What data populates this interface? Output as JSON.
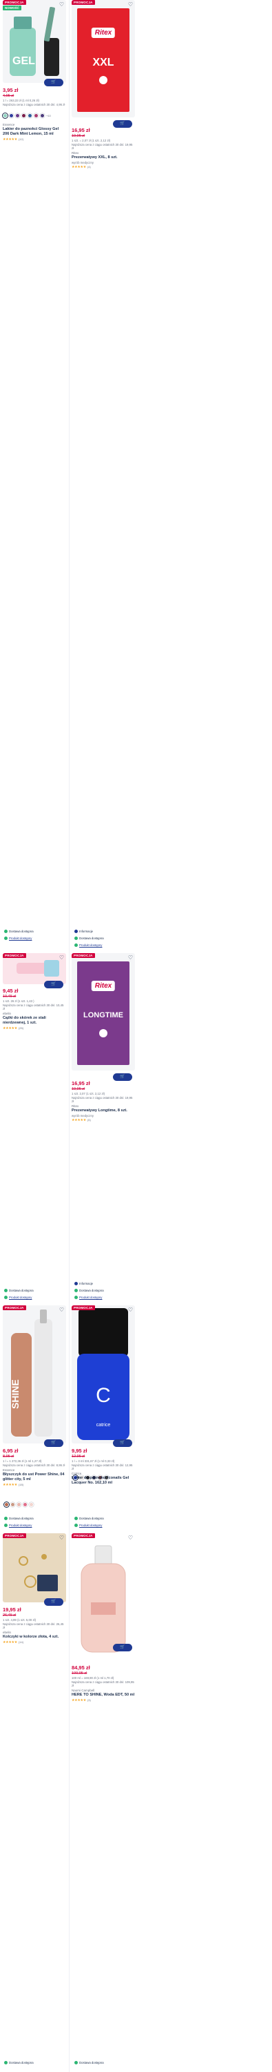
{
  "colors": {
    "accent": "#d2003c",
    "primary": "#1f3a93",
    "badge_green": "#2bb673",
    "star": "#f5a623"
  },
  "cart_icon": "cart-icon",
  "heart_icon": "heart-icon",
  "products": [
    {
      "badge": "PROMOCJA",
      "badge2": "NOWOŚĆ",
      "image_text": "GEL",
      "price": "3,95 zł",
      "old_price": "4,95 zł",
      "unit": "1 l = 263,33 zł (1 ml 0,26 zł)",
      "lowest": "Najniższa cena z ciągu ostatnich 30 dni: 4,95 zł",
      "brand": "Essence",
      "name": "Lakier do paznokci Glossy Gel 206 Dark Mint Lemon, 15 ml",
      "stars": "★★★★★",
      "reviews": "(12)",
      "swatches_more": "+10",
      "swatches": [
        "#8fd3c0",
        "#2f3e9e",
        "#6b3b8c",
        "#7a1f4a",
        "#2c5e9e",
        "#a93b6e",
        "#4c3b7c"
      ]
    },
    {
      "badge": "PROMOCJA",
      "image_brand": "Ritex",
      "image_text": "XXL",
      "price": "16,95 zł",
      "old_price": "19,95 zł",
      "unit": "1 szt. = 2,07 zł (1 szt. 2,12 zł)",
      "lowest": "Najniższa cena z ciągu ostatnich 30 dni: 19,95 zł",
      "brand": "Ritex",
      "name": "Prezerwatywy XXL, 8 szt.",
      "subinfo": "wyrób medyczny",
      "stars": "★★★★★",
      "reviews": "(4)"
    },
    {
      "badge": "PROMOCJA",
      "price": "9,45 zł",
      "old_price": "10,45 zł",
      "unit": "1 szt. 26 zł (1 szt. 1,43 )",
      "lowest": "Najniższa cena z ciągu ostatnich 30 dni: 10,45 zł",
      "brand": "ebelin",
      "name": "Cążki do skórek ze stali nierdzewnej, 1 szt.",
      "stars": "★★★★★",
      "reviews": "(25)"
    },
    {
      "badge": "PROMOCJA",
      "image_brand": "Ritex",
      "image_text": "LONGTIME",
      "price": "16,95 zł",
      "old_price": "19,95 zł",
      "unit": "1 szt. 2,07 (1 szt. 2,12 zł)",
      "lowest": "Najniższa cena z ciągu ostatnich 30 dni: 19,95 zł",
      "brand": "Ritex",
      "name": "Prezerwatywy Longtime, 8 szt.",
      "subinfo": "wyrób medyczny",
      "stars": "★★★★★",
      "reviews": "(5)"
    },
    {
      "badge": "PROMOCJA",
      "image_text": "SHINE",
      "price": "6,95 zł",
      "old_price": "8,95 zł",
      "unit": "1 l = 1 272,36 zł (1 ml 1,27 zł)",
      "lowest": "Najniższa cena z ciągu ostatnich 30 dni: 8,95 zł",
      "brand": "Essence",
      "name": "Błyszczyk do ust Power Shine, 04 glitter city, 5 ml",
      "stars": "★★★★★",
      "reviews": "(18)",
      "swatches": [
        "#b86a4e",
        "#c99a85",
        "#e8b8b0",
        "#e06e8a",
        "#f2d5cf"
      ]
    },
    {
      "badge": "PROMOCJA",
      "image_text": "catrice",
      "price": "9,95 zł",
      "old_price": "12,95 zł",
      "unit": "1 l = 3 ml 331,67 zł (1 ml 0,33 zł)",
      "lowest": "Najniższa cena z ciągu ostatnich 30 dni: 12,95 zł",
      "brand": "Catrice",
      "name": "Lakier do paznokci Iconails Gel Lacquer No. 162,10 ml",
      "stars": "★★★★★",
      "reviews": "(9)",
      "swatches": [
        "#1e3fd4",
        "#e8e2d8",
        "#1a1a1a",
        "#2a2a4a",
        "#6b3b3b",
        "#3b3b3b"
      ]
    },
    {
      "badge": "PROMOCJA",
      "price": "19,95 zł",
      "old_price": "26,45 zł",
      "unit": "1 szt. 4,99 (1 szt. 5,00 zł)",
      "lowest": "Najniższa cena z ciągu ostatnich 30 dni: 26,45 zł",
      "brand": "ebelin",
      "name": "Kolczyki w kolorze złota, 4 szt.",
      "stars": "★★★★★",
      "reviews": "(14)"
    },
    {
      "badge": "PROMOCJA",
      "price": "84,95 zł",
      "old_price": "109,95 zł",
      "unit": "100 ml = 169,90 zł (1 ml 1,70 zł)",
      "lowest": "Najniższa cena z ciągu ostatnich 30 dni: 109,95 zł",
      "brand": "Naomi Campbell",
      "name": "HERE TO SHINE, Woda EDT, 50 ml",
      "stars": "★★★★★",
      "reviews": "(3)"
    }
  ],
  "availability": {
    "online": "Dostawa dostępna",
    "store": "Produkt dostępny",
    "info": "Informacje"
  }
}
